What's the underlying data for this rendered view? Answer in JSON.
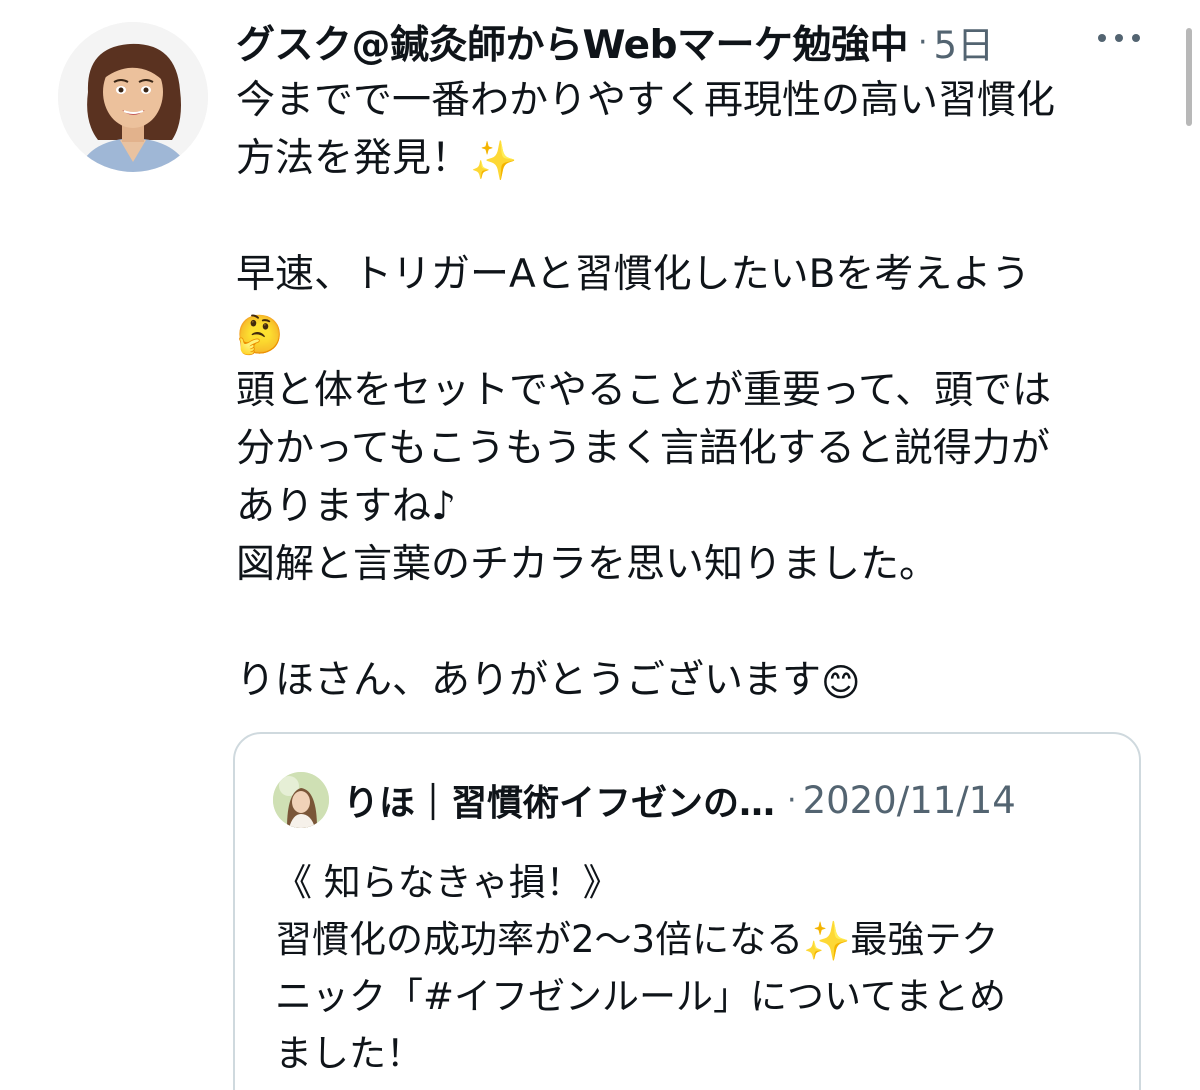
{
  "tweet": {
    "author": {
      "display_name": "グスク@鍼灸師からWebマーケ勉強中",
      "avatar_icon": "user-avatar-icon"
    },
    "separator": "·",
    "timestamp": "5日",
    "more_icon": "more-horizontal-icon",
    "body_lines": [
      "今までで一番わかりやすく再現性の高い習慣化",
      "方法を発見！",
      "",
      "早速、トリガーAと習慣化したいBを考えよう",
      "",
      "頭と体をセットでやることが重要って、頭では",
      "分かってもこうもうまく言語化すると説得力が",
      "ありますね♪",
      "図解と言葉のチカラを思い知りました。",
      "",
      "りほさん、ありがとうございます"
    ],
    "emojis": {
      "sparkles": "✨",
      "thinking": "🤔",
      "smile": "😊"
    }
  },
  "quoted_tweet": {
    "author": {
      "display_name": "りほ｜習慣術イフゼンの…",
      "avatar_icon": "quoted-user-avatar-icon"
    },
    "separator": "·",
    "timestamp": "2020/11/14",
    "body_lines": [
      "《 知らなきゃ損！》",
      "習慣化の成功率が2〜3倍になる",
      "最強テク",
      "ニック「#イフゼンルール」についてまとめ",
      "ました！"
    ],
    "emoji_sparkles": "✨"
  },
  "colors": {
    "text_primary": "#0f1419",
    "text_secondary": "#536471",
    "border": "#cfd9de",
    "background": "#ffffff"
  }
}
